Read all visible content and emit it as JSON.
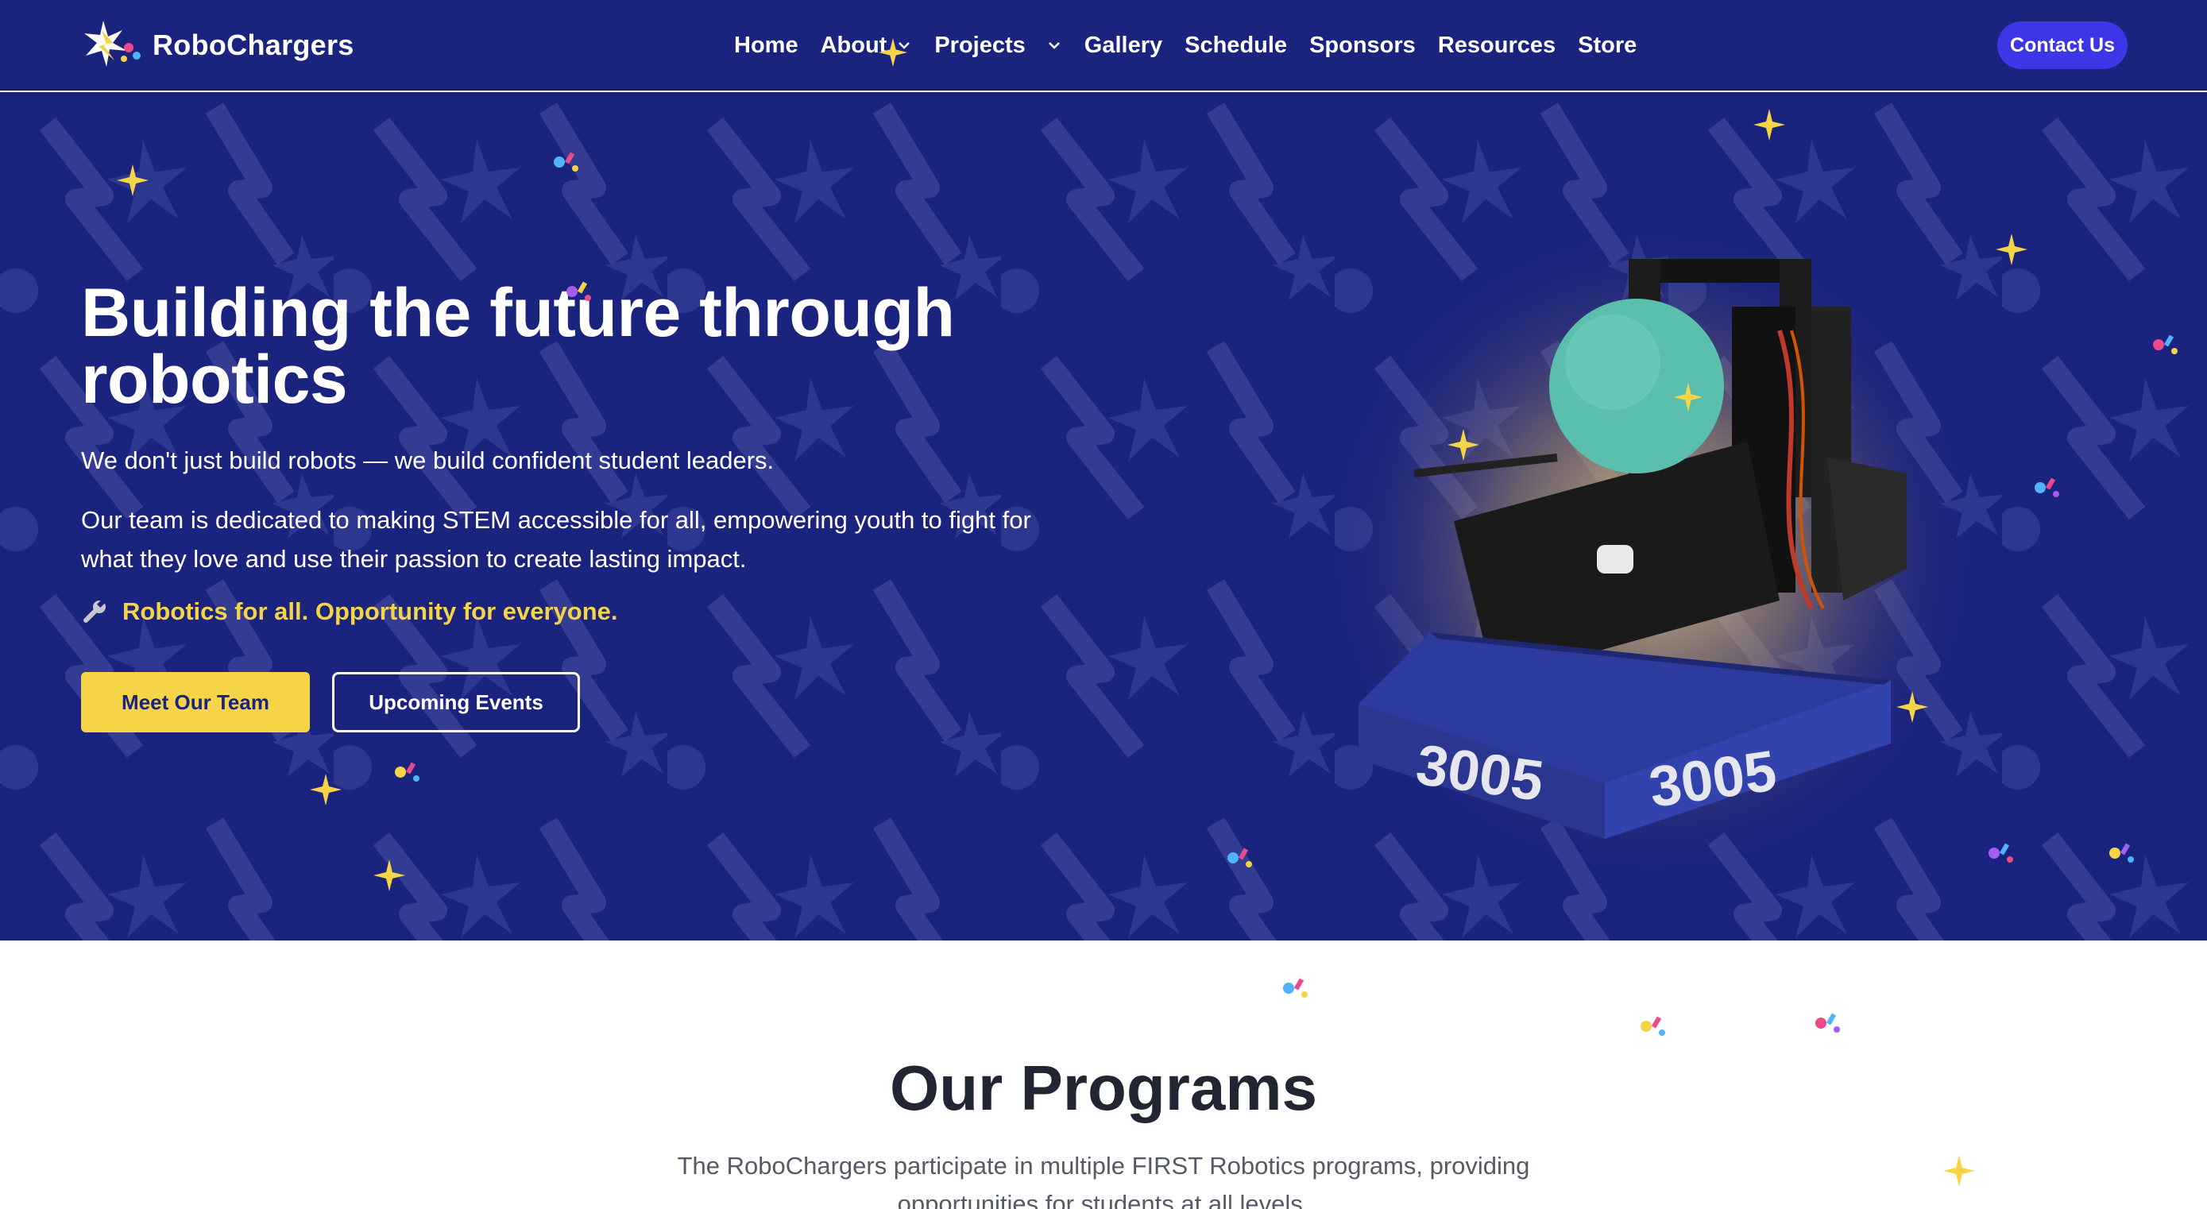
{
  "brand": {
    "name": "RoboChargers"
  },
  "nav": {
    "items": [
      {
        "label": "Home",
        "dropdown": false
      },
      {
        "label": "About",
        "dropdown": true
      },
      {
        "label": "Projects",
        "dropdown": true
      },
      {
        "label": "Gallery",
        "dropdown": false
      },
      {
        "label": "Schedule",
        "dropdown": false
      },
      {
        "label": "Sponsors",
        "dropdown": false
      },
      {
        "label": "Resources",
        "dropdown": false
      },
      {
        "label": "Store",
        "dropdown": false
      }
    ],
    "contact_label": "Contact Us"
  },
  "hero": {
    "title_line1": "Building the future through",
    "title_line2": "robotics",
    "subtitle": "We don't just build robots — we build confident student leaders.",
    "body": "Our team is dedicated to making STEM accessible for all, empowering youth to fight for what they love and use their passion to create lasting impact.",
    "tagline": "Robotics for all. Opportunity for everyone.",
    "primary_cta": "Meet Our Team",
    "secondary_cta": "Upcoming Events",
    "robot_number": "3005"
  },
  "programs": {
    "title": "Our Programs",
    "description": "The RoboChargers participate in multiple FIRST Robotics programs, providing opportunities for students at all levels."
  },
  "colors": {
    "nav_bg": "#1a237e",
    "accent_yellow": "#f5d547",
    "contact_button": "#3d36e6",
    "heading_dark": "#222633"
  }
}
